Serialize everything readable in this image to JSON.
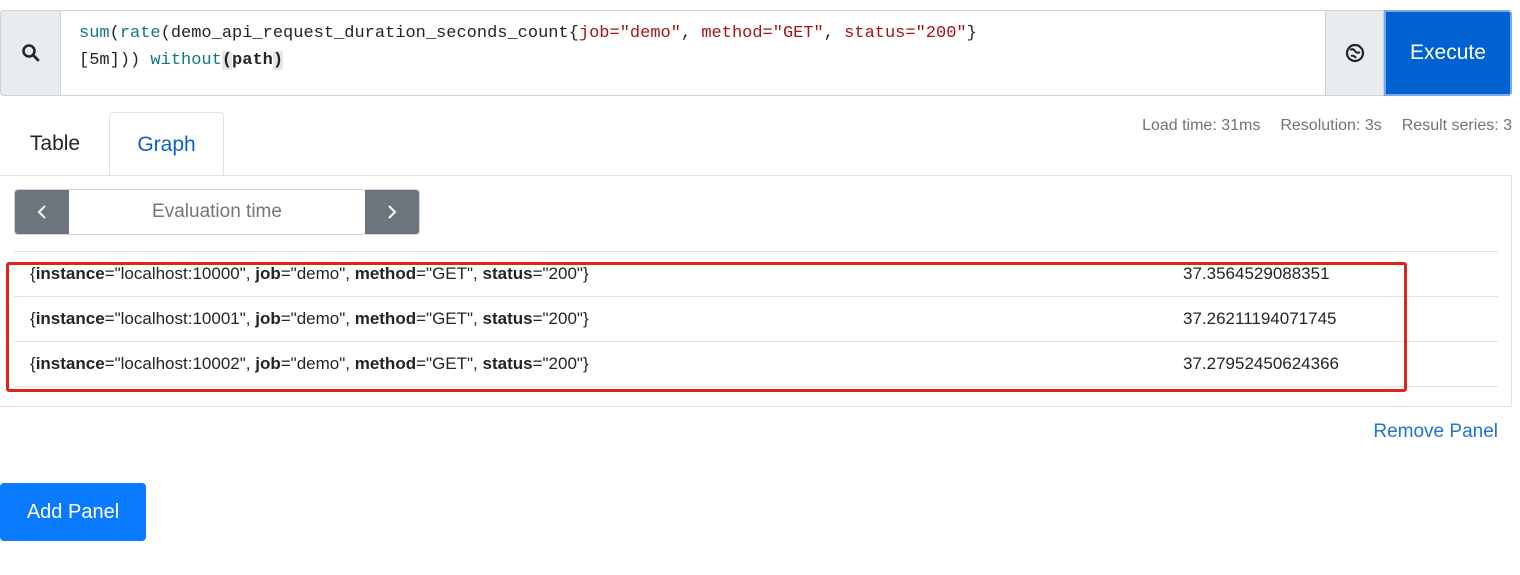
{
  "query": {
    "expression_parts": [
      {
        "t": "sum",
        "c": "fn"
      },
      {
        "t": "(",
        "c": ""
      },
      {
        "t": "rate",
        "c": "fn"
      },
      {
        "t": "(demo_api_request_duration_seconds_count{",
        "c": ""
      },
      {
        "t": "job=\"demo\"",
        "c": "str"
      },
      {
        "t": ", ",
        "c": ""
      },
      {
        "t": "method=\"GET\"",
        "c": "str"
      },
      {
        "t": ", ",
        "c": ""
      },
      {
        "t": "status=\"200\"",
        "c": "str"
      },
      {
        "t": "}",
        "c": ""
      }
    ],
    "line2_range": "[5m]",
    "line2_close": ")) ",
    "line2_without": "without",
    "line2_open": "(",
    "line2_path": "path",
    "line2_closep": ")",
    "execute_label": "Execute"
  },
  "tabs": [
    {
      "label": "Table",
      "active": true
    },
    {
      "label": "Graph",
      "active": false
    }
  ],
  "stats": {
    "load_time": "Load time: 31ms",
    "resolution": "Resolution: 3s",
    "result_series": "Result series: 3"
  },
  "evaluation": {
    "placeholder": "Evaluation time"
  },
  "results": [
    {
      "instance": "localhost:10000",
      "job": "demo",
      "method": "GET",
      "status": "200",
      "value": "37.3564529088351"
    },
    {
      "instance": "localhost:10001",
      "job": "demo",
      "method": "GET",
      "status": "200",
      "value": "37.26211194071745"
    },
    {
      "instance": "localhost:10002",
      "job": "demo",
      "method": "GET",
      "status": "200",
      "value": "37.27952450624366"
    }
  ],
  "remove_panel_label": "Remove Panel",
  "add_panel_label": "Add Panel",
  "colors": {
    "accent": "#0a7bff",
    "highlight": "#e0241b"
  }
}
